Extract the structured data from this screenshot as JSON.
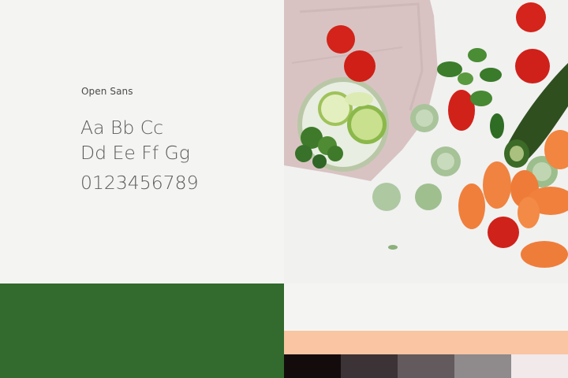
{
  "typography": {
    "font_name": "Open Sans",
    "line1": "Aa Bb Cc",
    "line2": "Dd Ee Ff Gg",
    "digits": "0123456789"
  },
  "palette": {
    "primary_green": "#336a2d",
    "light": "#f4f5f2",
    "peach": "#f9c5a3",
    "neutrals": [
      "#140c0c",
      "#3b3335",
      "#625a5c",
      "#8f8a8c",
      "#f2e9ea"
    ]
  }
}
